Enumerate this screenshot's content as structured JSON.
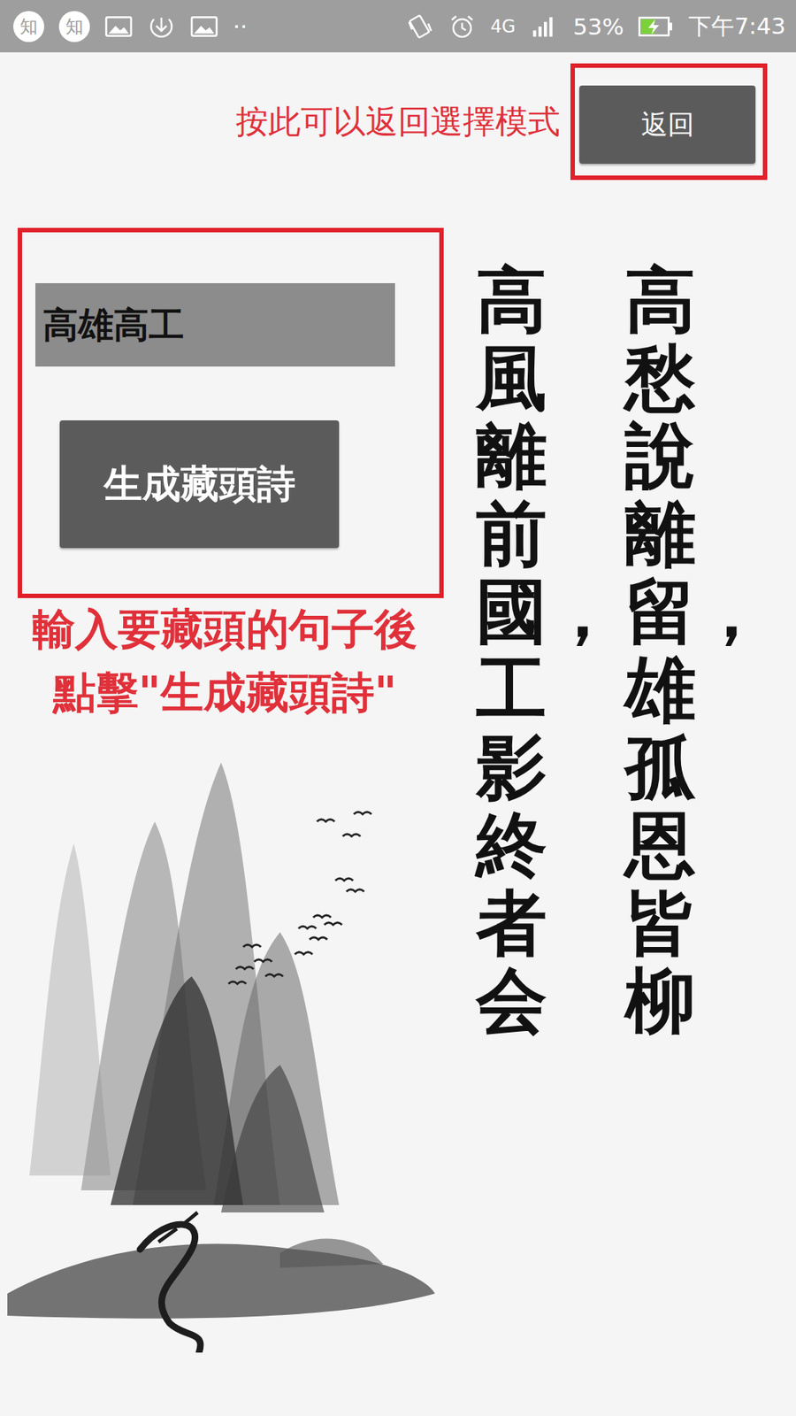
{
  "status_bar": {
    "app_icons": [
      "知",
      "知"
    ],
    "more": "··",
    "network": "4G",
    "battery": "53%",
    "battery_level": 0.53,
    "charging": true,
    "time": "下午7:43"
  },
  "back_hint": "按此可以返回選擇模式",
  "back_button": "返回",
  "input": {
    "value": "高雄高工"
  },
  "generate_button": "生成藏頭詩",
  "instructions": [
    "輸入要藏頭的句子後",
    "點擊\"生成藏頭詩\""
  ],
  "poem": {
    "lines": [
      "高愁說離留，雄孤恩皆柳",
      "高風離前國，工影終者会"
    ]
  }
}
